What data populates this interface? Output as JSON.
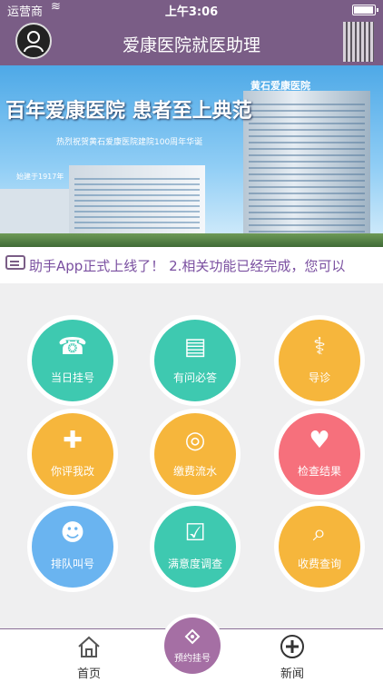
{
  "status_bar": {
    "carrier": "运营商",
    "time": "上午3:06",
    "battery_level": 0.95
  },
  "nav": {
    "title": "爱康医院就医助理",
    "avatar_icon": "user-avatar-icon",
    "qr_icon": "qr-code-icon"
  },
  "banner": {
    "slogan": "百年爱康医院  患者至上典范",
    "subtitle": "热烈祝贺黄石爱康医院建院100周年华诞",
    "since": "始建于1917年",
    "sign": "黄石爱康医院"
  },
  "notice": {
    "icon": "message-icon",
    "text": "助手App正式上线了！      2.相关功能已经完成，您可以"
  },
  "menu": {
    "items": [
      {
        "label": "当日挂号",
        "icon": "phone-icon",
        "color": "#3ec9b0"
      },
      {
        "label": "有问必答",
        "icon": "document-icon",
        "color": "#3ec9b0"
      },
      {
        "label": "导诊",
        "icon": "stethoscope-icon",
        "color": "#f6b63c"
      },
      {
        "label": "你评我改",
        "icon": "clipboard-icon",
        "color": "#f6b63c"
      },
      {
        "label": "缴费流水",
        "icon": "coins-icon",
        "color": "#f6b63c"
      },
      {
        "label": "检查结果",
        "icon": "heart-rate-icon",
        "color": "#f6707c"
      },
      {
        "label": "排队叫号",
        "icon": "people-icon",
        "color": "#6ab4f0"
      },
      {
        "label": "满意度调查",
        "icon": "checklist-icon",
        "color": "#3ec9b0"
      },
      {
        "label": "收费查询",
        "icon": "search-document-icon",
        "color": "#f6b63c"
      }
    ]
  },
  "tabbar": {
    "home_label": "首页",
    "home_icon": "home-icon",
    "center_label": "预约挂号",
    "center_icon": "appointment-icon",
    "news_label": "新闻",
    "news_icon": "plus-circle-icon"
  },
  "colors": {
    "theme": "#7a5d86",
    "center_button": "#a56fa4"
  }
}
